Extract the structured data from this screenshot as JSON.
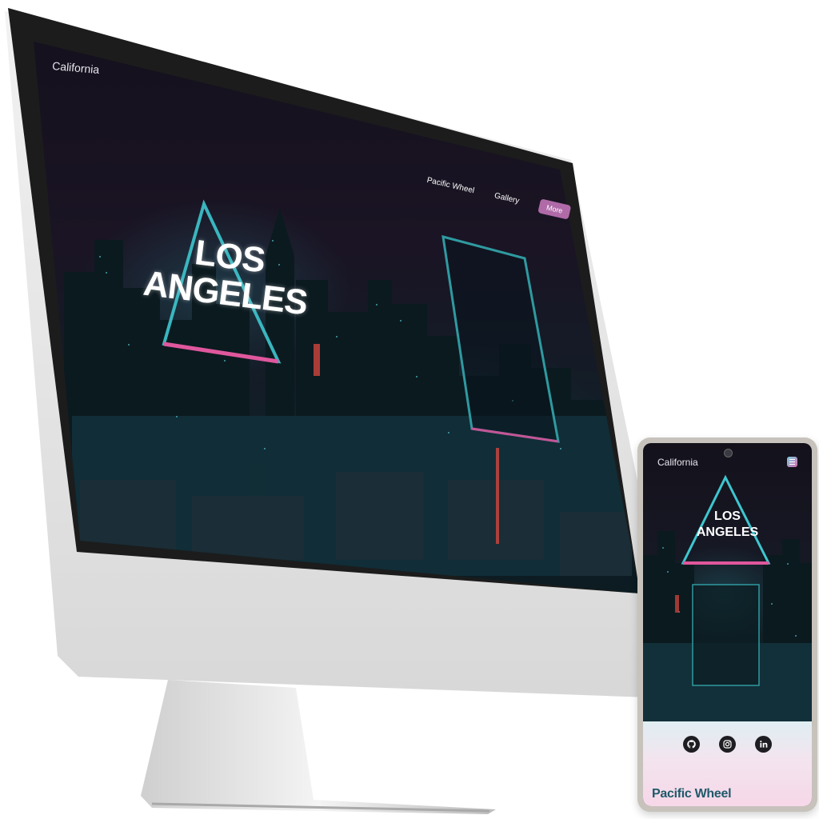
{
  "desktop": {
    "brand": "California",
    "nav": {
      "pacific_wheel": "Pacific Wheel",
      "gallery": "Gallery",
      "more": "More"
    },
    "hero": {
      "title_line1": "LOS",
      "title_line2": "ANGELES"
    }
  },
  "mobile": {
    "brand": "California",
    "menu_icon": "hamburger-menu-icon",
    "hero": {
      "title_line1": "LOS",
      "title_line2": "ANGELES"
    },
    "social": [
      "github-icon",
      "instagram-icon",
      "linkedin-icon"
    ],
    "section_title": "Pacific Wheel"
  },
  "colors": {
    "neon_cyan": "#3ec6cf",
    "neon_pink": "#e0579d",
    "accent_purple": "#b06aa8",
    "heading_teal": "#1e5a6a"
  }
}
